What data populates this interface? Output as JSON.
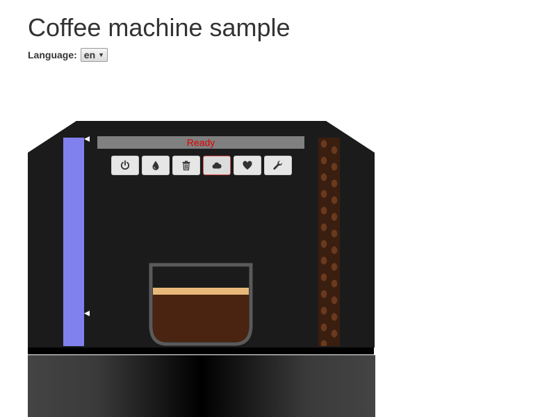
{
  "page": {
    "title": "Coffee machine sample"
  },
  "language": {
    "label": "Language:",
    "selected": "en"
  },
  "machine": {
    "status": "Ready",
    "status_color": "#e00000",
    "water_color": "#8080ee",
    "coffee_color": "#4a2410",
    "crema_color": "#e8b87a",
    "buttons": [
      {
        "icon": "power-icon",
        "active": false
      },
      {
        "icon": "water-drop-icon",
        "active": false
      },
      {
        "icon": "trash-icon",
        "active": false
      },
      {
        "icon": "cloud-icon",
        "active": true
      },
      {
        "icon": "heart-icon",
        "active": false
      },
      {
        "icon": "wrench-icon",
        "active": false
      }
    ]
  }
}
